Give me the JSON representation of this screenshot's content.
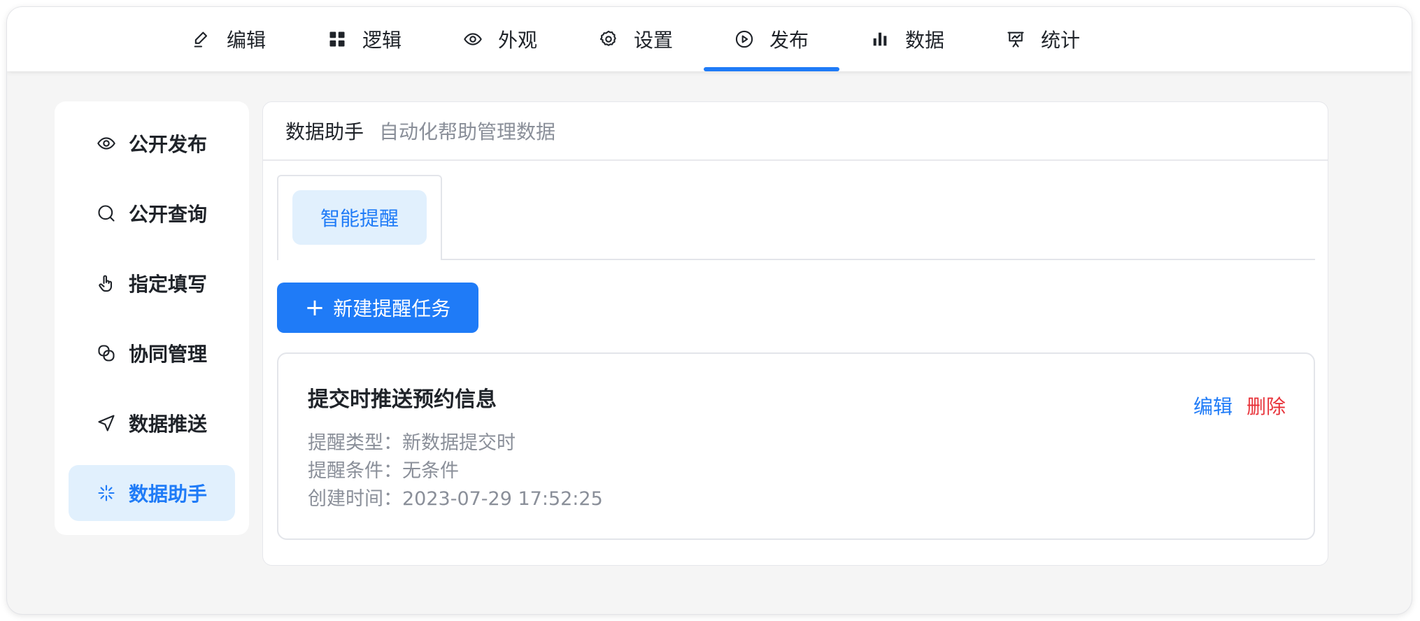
{
  "topnav": {
    "items": [
      {
        "label": "编辑",
        "icon": "pen-icon"
      },
      {
        "label": "逻辑",
        "icon": "grid-icon"
      },
      {
        "label": "外观",
        "icon": "eye-icon"
      },
      {
        "label": "设置",
        "icon": "gear-icon"
      },
      {
        "label": "发布",
        "icon": "play-circle-icon"
      },
      {
        "label": "数据",
        "icon": "bar-chart-icon"
      },
      {
        "label": "统计",
        "icon": "presentation-icon"
      }
    ],
    "active_index": 4,
    "accent_color": "#1f7bf7"
  },
  "sidebar": {
    "items": [
      {
        "label": "公开发布",
        "icon": "eye-icon"
      },
      {
        "label": "公开查询",
        "icon": "search-icon"
      },
      {
        "label": "指定填写",
        "icon": "hand-pointer-icon"
      },
      {
        "label": "协同管理",
        "icon": "link-icon"
      },
      {
        "label": "数据推送",
        "icon": "send-icon"
      },
      {
        "label": "数据助手",
        "icon": "sparkle-icon"
      }
    ],
    "active_index": 5
  },
  "panel": {
    "title": "数据助手",
    "subtitle": "自动化帮助管理数据",
    "tab": "智能提醒",
    "new_button": "新建提醒任务",
    "task": {
      "title": "提交时推送预约信息",
      "type_line": "提醒类型：新数据提交时",
      "condition_line": "提醒条件：无条件",
      "created_line": "创建时间：2023-07-29 17:52:25",
      "edit": "编辑",
      "delete": "删除"
    }
  },
  "colors": {
    "primary": "#1f7bf7",
    "danger": "#e8343b",
    "muted_text": "#8a8f99",
    "active_bg": "#e1f0fd"
  }
}
